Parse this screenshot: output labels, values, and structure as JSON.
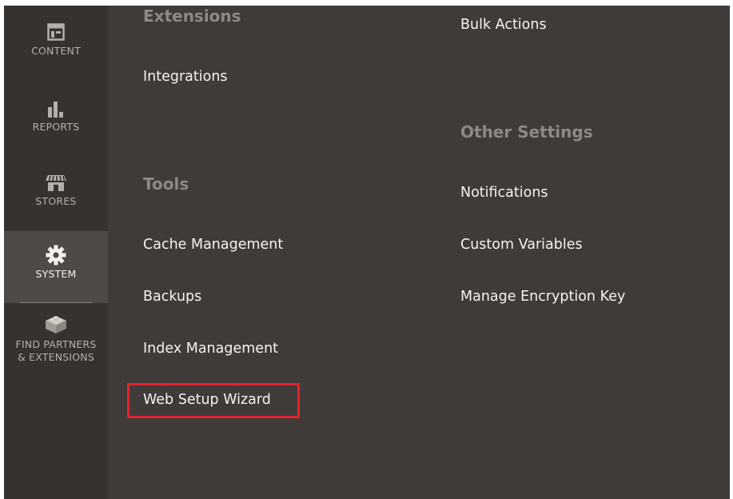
{
  "sidebar": {
    "items": [
      {
        "label": "CONTENT",
        "icon": "content-icon"
      },
      {
        "label": "REPORTS",
        "icon": "reports-icon"
      },
      {
        "label": "STORES",
        "icon": "stores-icon"
      },
      {
        "label": "SYSTEM",
        "icon": "gear-icon",
        "active": true
      },
      {
        "label_line1": "FIND PARTNERS",
        "label_line2": "& EXTENSIONS",
        "icon": "lego-block-icon"
      }
    ]
  },
  "flyout": {
    "left_column": {
      "extensions_title": "Extensions",
      "integrations": "Integrations",
      "tools_title": "Tools",
      "cache_management": "Cache Management",
      "backups": "Backups",
      "index_management": "Index Management",
      "web_setup_wizard": "Web Setup Wizard"
    },
    "right_column": {
      "bulk_actions": "Bulk Actions",
      "other_settings_title": "Other Settings",
      "notifications": "Notifications",
      "custom_variables": "Custom Variables",
      "manage_encryption_key": "Manage Encryption Key"
    }
  },
  "colors": {
    "sidebar_bg": "#353230",
    "flyout_bg": "#403b39",
    "active_bg": "#504a46",
    "section_title": "#8f8883",
    "link_text": "#f5f3f1",
    "highlight_border": "#e5232d"
  }
}
